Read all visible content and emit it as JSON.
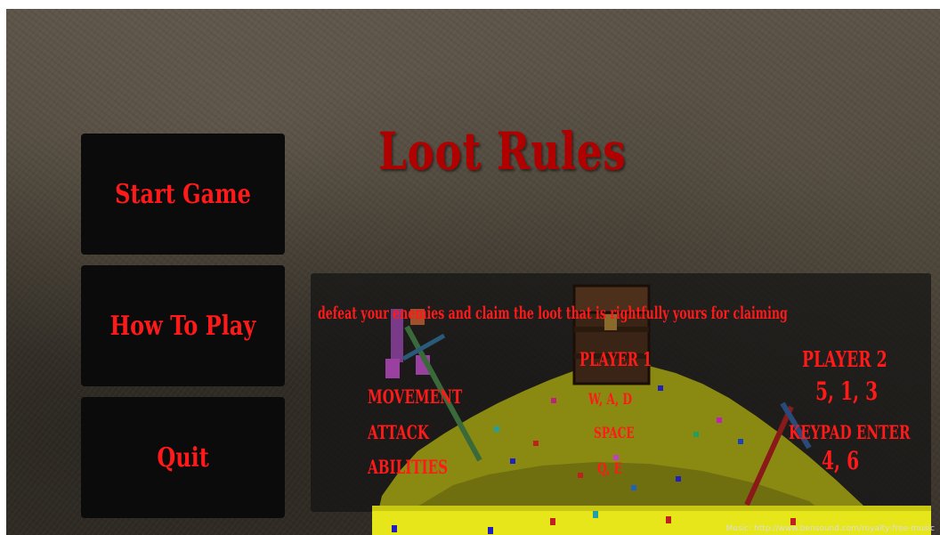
{
  "title": "Loot Rules",
  "menu": {
    "start_label": "Start Game",
    "howto_label": "How To Play",
    "quit_label": "Quit"
  },
  "rules": {
    "tagline": "defeat your enemies and claim the loot that is rightfully yours for claiming",
    "player1_header": "PLAYER 1",
    "player2_header": "PLAYER 2",
    "rows": [
      {
        "label": "MOVEMENT",
        "player1": "W, A, D",
        "player2": "5, 1, 3"
      },
      {
        "label": "ATTACK",
        "player1": "SPACE",
        "player2": "KEYPAD ENTER"
      },
      {
        "label": "ABILITIES",
        "player1": "Q, E",
        "player2": "4, 6"
      }
    ]
  },
  "footer": {
    "music_credit": "Music: http://www.bensound.com/royalty-free-music"
  },
  "colors": {
    "accent_red": "#ff1a1a",
    "title_red": "#b00000",
    "button_bg": "#0b0b0b",
    "gold_pile": "#8a8a12",
    "gold_light": "#e6e61a"
  }
}
